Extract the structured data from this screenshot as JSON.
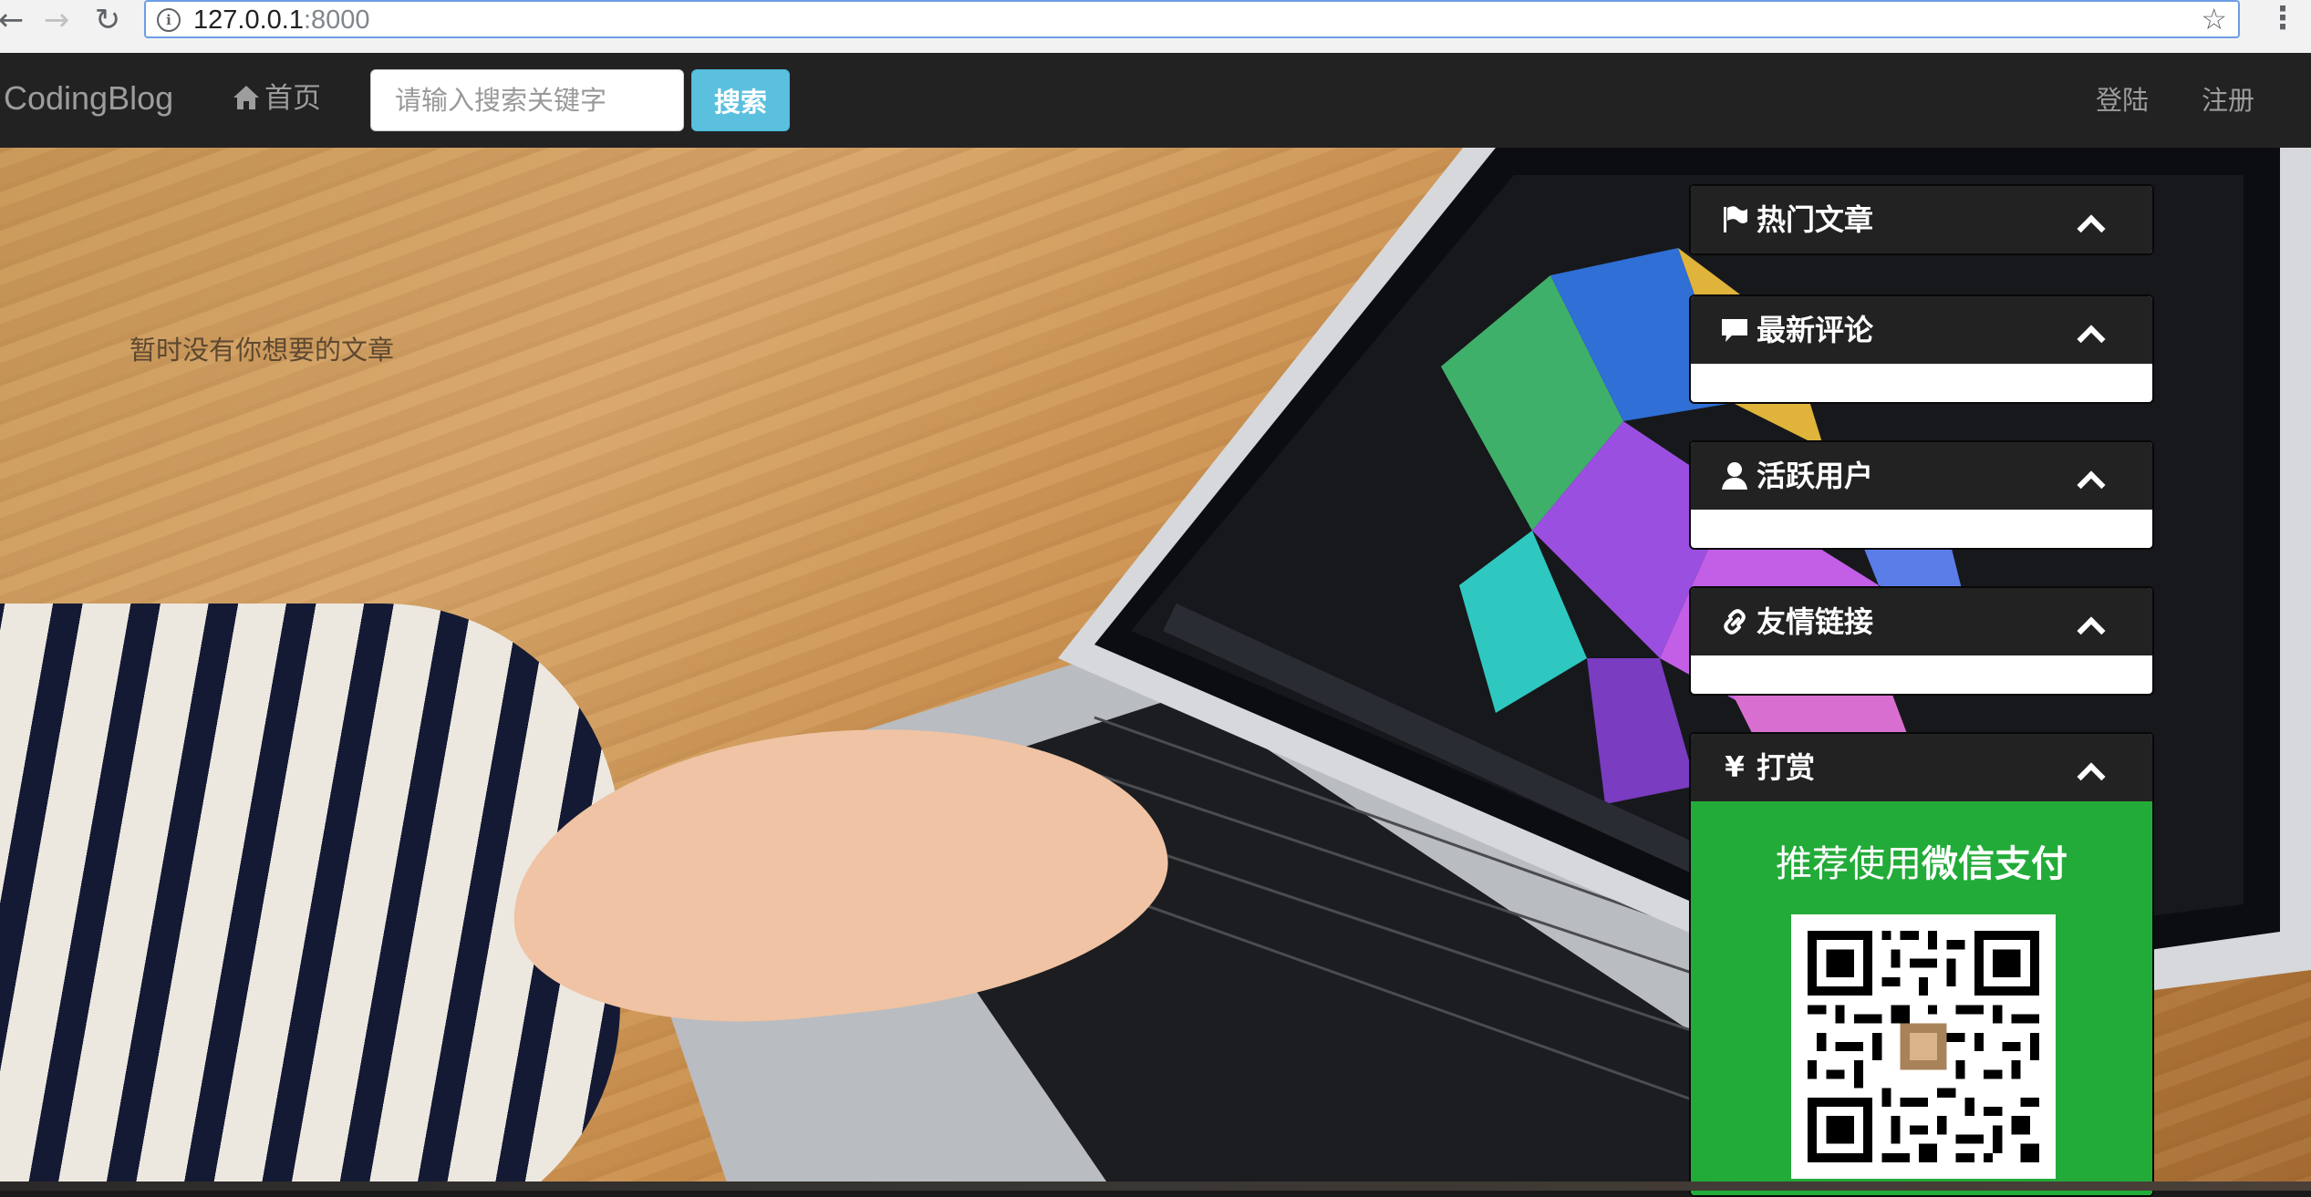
{
  "browser": {
    "url_host": "127.0.0.1",
    "url_port": ":8000"
  },
  "navbar": {
    "brand": "CodingBlog",
    "home_label": "首页",
    "search_placeholder": "请输入搜索关键字",
    "search_button": "搜索",
    "login": "登陆",
    "register": "注册"
  },
  "main": {
    "empty_message": "暂时没有你想要的文章"
  },
  "sidebar": {
    "hot_articles": {
      "title": "热门文章",
      "icon": "flag-icon"
    },
    "latest_comments": {
      "title": "最新评论",
      "icon": "comment-icon"
    },
    "active_users": {
      "title": "活跃用户",
      "icon": "user-icon"
    },
    "friend_links": {
      "title": "友情链接",
      "icon": "link-icon"
    },
    "reward": {
      "title": "打赏",
      "icon": "yen-icon",
      "text_prefix": "推荐使用",
      "text_bold": "微信支付"
    }
  },
  "colors": {
    "navbar_bg": "#222222",
    "search_button_bg": "#5bc0de",
    "reward_bg": "#22ab38"
  }
}
